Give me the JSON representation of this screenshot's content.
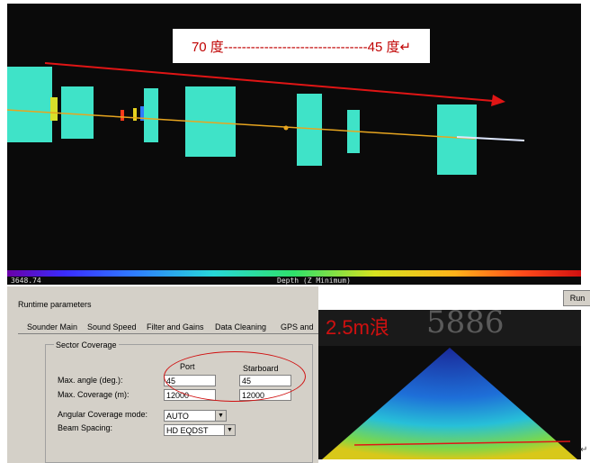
{
  "annotation": {
    "text": "70 度--------------------------------45 度↵"
  },
  "depth_bar": {
    "value": "3648.74",
    "title": "Depth (Z Minimum)"
  },
  "panel": {
    "title": "Runtime parameters",
    "tabs": [
      "Sounder Main",
      "Sound Speed",
      "Filter and Gains",
      "Data Cleaning",
      "GPS and"
    ],
    "group_title": "Sector Coverage",
    "columns": {
      "port": "Port",
      "starboard": "Starboard"
    },
    "max_angle": {
      "label": "Max. angle (deg.):",
      "port": "45",
      "starboard": "45"
    },
    "max_coverage": {
      "label": "Max. Coverage (m):",
      "port": "12000",
      "starboard": "12000"
    },
    "angular_mode": {
      "label": "Angular Coverage mode:",
      "value": "AUTO"
    },
    "beam_spacing": {
      "label": "Beam Spacing:",
      "value": "HD EQDST"
    }
  },
  "run_button": {
    "label": "Run"
  },
  "inset": {
    "wave_label": "2.5m浪",
    "bg_digits": "5886"
  },
  "colors": {
    "accent_red": "#d01010",
    "cyan_points": "#3fe3c8",
    "track": "#e7a51f"
  }
}
